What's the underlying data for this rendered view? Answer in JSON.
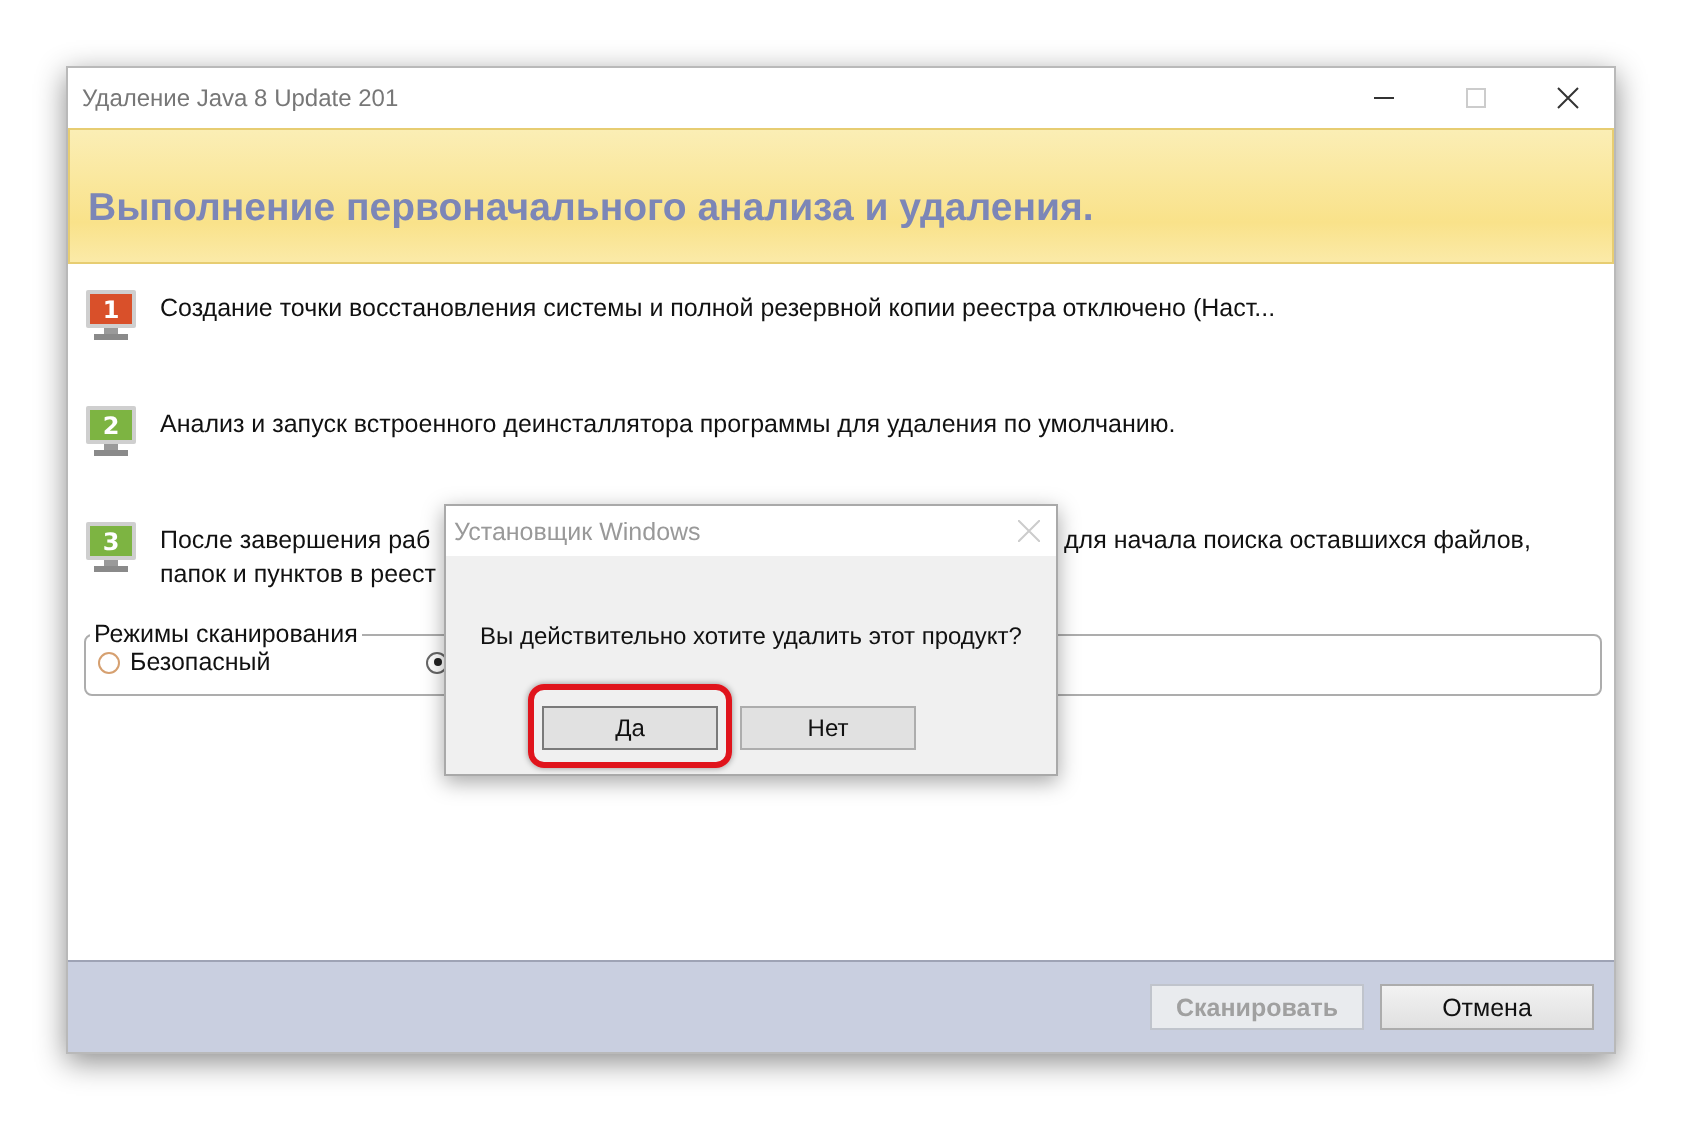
{
  "window": {
    "title": "Удаление Java 8 Update 201"
  },
  "banner": {
    "heading": "Выполнение первоначального анализа и удаления."
  },
  "steps": [
    {
      "number": "1",
      "color": "#d9502a",
      "lines": [
        [
          "Создание точки восстановления системы и полной резервной копии реестра отключено (Наст..."
        ]
      ]
    },
    {
      "number": "2",
      "color": "#7db442",
      "lines": [
        [
          "Анализ и запуск встроенного деинсталлятора программы для удаления по умолчанию."
        ]
      ]
    },
    {
      "number": "3",
      "color": "#7db442",
      "lines": [
        [
          "После завершения раб",
          "для начала поиска оставшихся файлов,"
        ],
        [
          "папок и пунктов в реест"
        ]
      ]
    }
  ],
  "scan_modes": {
    "legend": "Режимы сканирования",
    "options": [
      {
        "label": "Безопасный",
        "selected": false
      },
      {
        "selected": true
      }
    ]
  },
  "footer": {
    "buttons": [
      {
        "label": "Сканировать",
        "disabled": true
      },
      {
        "label": "Отмена",
        "disabled": false
      }
    ]
  },
  "dialog": {
    "title": "Установщик Windows",
    "message": "Вы действительно хотите удалить этот продукт?",
    "buttons": [
      {
        "label": "Да",
        "highlighted": true
      },
      {
        "label": "Нет",
        "highlighted": false
      }
    ]
  }
}
